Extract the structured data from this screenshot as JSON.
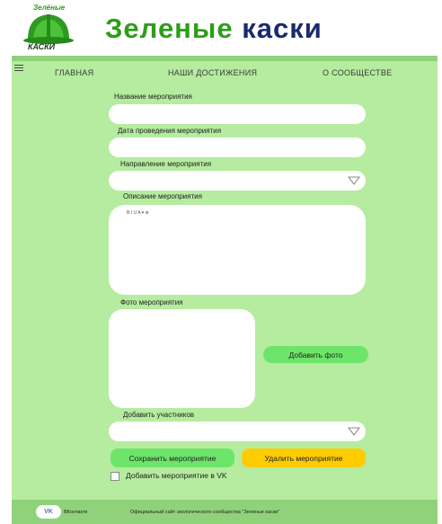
{
  "header": {
    "logo_top_text": "Зелёные",
    "logo_bottom_text": "КАСКИ",
    "title_part1": "Зеленые",
    "title_part2": "каски"
  },
  "nav": {
    "items": [
      {
        "label": "ГЛАВНАЯ"
      },
      {
        "label": "НАШИ ДОСТИЖЕНИЯ"
      },
      {
        "label": "О СООБЩЕСТВЕ"
      }
    ]
  },
  "form": {
    "name_label": "Название мероприятия",
    "name_value": "",
    "date_label": "Дата проведения мероприятия",
    "date_value": "",
    "direction_label": "Направление мероприятия",
    "direction_value": "",
    "description_label": "Описание мероприятия",
    "editor_toolbar": "B  I  U  A ▾  ⊕",
    "description_value": "",
    "photo_label": "Фото мероприятия",
    "add_photo_button": "Добавить фото",
    "participants_label": "Добавить участников",
    "participants_value": "",
    "save_button": "Сохранить мероприятие",
    "delete_button": "Удалить мероприятие",
    "vk_checkbox_label": "Добавить мероприятие в VK",
    "vk_checkbox_checked": false
  },
  "footer": {
    "vk_badge": "VK",
    "vk_label": "ВКонтакте",
    "site_text": "Официальный сайт экологического сообщества \"Зеленые каски\""
  },
  "colors": {
    "page_bg": "#b5ec9f",
    "header_strip": "#8fd27a",
    "title_green": "#2e9d1a",
    "title_dark": "#1a2a6e",
    "save_button": "#6de56a",
    "delete_button": "#ffcc00",
    "add_photo_button": "#6de56a"
  }
}
